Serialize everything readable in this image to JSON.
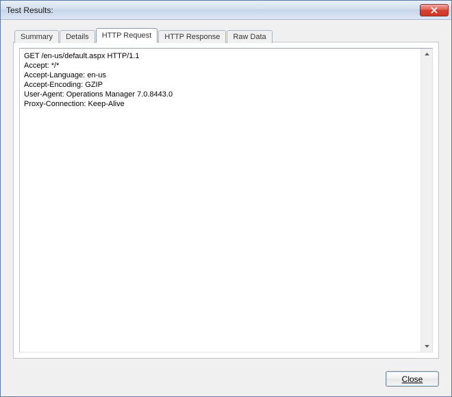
{
  "window": {
    "title": "Test Results:"
  },
  "tabs": {
    "summary": "Summary",
    "details": "Details",
    "http_request": "HTTP Request",
    "http_response": "HTTP Response",
    "raw_data": "Raw Data"
  },
  "http_request_body": "GET /en-us/default.aspx HTTP/1.1\nAccept: */*\nAccept-Language: en-us\nAccept-Encoding: GZIP\nUser-Agent: Operations Manager 7.0.8443.0\nProxy-Connection: Keep-Alive",
  "buttons": {
    "close": "Close"
  }
}
